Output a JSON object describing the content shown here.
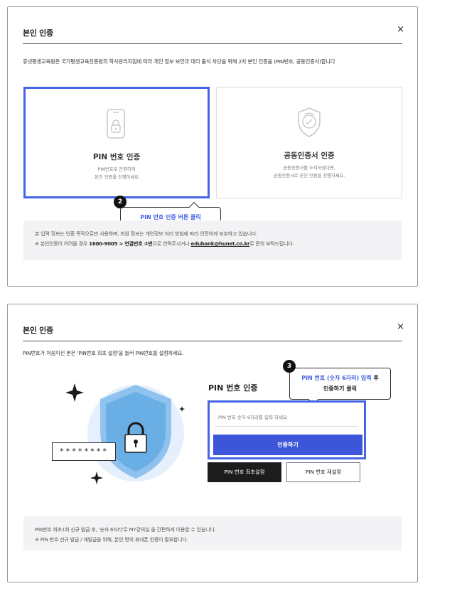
{
  "dialog1": {
    "title": "본인 인증",
    "close": "×",
    "description": "휴넷평생교육원은 국가평생교육진흥원의 학사관리지침에 따라 개인 정보 보안과 대리 출석 차단을 위해 2차 본인 인증을 (PIN번호, 공동인증서)합니다",
    "cards": [
      {
        "title": "PIN 번호 인증",
        "sub1": "PIN번호로 간편하게",
        "sub2": "본인 인증을 진행하세요",
        "icon": "phone-lock-icon",
        "selected": true
      },
      {
        "title": "공동인증서 인증",
        "sub1": "공동인증서를 소지하셨다면,",
        "sub2": "공동인증서로 본인 인증을 진행하세요.",
        "icon": "shield-certificate-icon",
        "selected": false
      }
    ],
    "step_badge": "2",
    "tooltip": "PIN 번호 인증 버튼 클릭",
    "note": {
      "line1": "본 입력 정보는 인증 목적으로만 사용하며, 회원 정보는 개인정보 처리 방침에 따라 안전하게 보호하고 있습니다.",
      "line2_prefix": "※ 본인인증이 어려울 경우 ",
      "line2_phone": "1600-9005 > 연결번호 ②번",
      "line2_mid": "으로 연락주시거나 ",
      "line2_email": "edubank@hunet.co.kr",
      "line2_suffix": "로 문의 부탁드립니다."
    }
  },
  "dialog2": {
    "title": "본인 인증",
    "close": "×",
    "description": "PIN번호가 처음이신 분은 'PIN번호 최초 설정'을 눌러 PIN번호를 설정하세요.",
    "illustration_text": "********",
    "pin_title": "PIN 번호 인증",
    "pin_placeholder": "PIN 번호 숫자 6자리를 입력 하세요",
    "submit_label": "인증하기",
    "first_setup_label": "PIN 번호 최초설정",
    "reset_label": "PIN 번호 재설정",
    "step_badge": "3",
    "tooltip_blue": "PIN 번호 (숫자 6자리) 입력",
    "tooltip_black": " 후",
    "tooltip_line2": "인증하기 클릭",
    "note": {
      "line1": "PIN번호 최초1회 신규 발급 후, '숫자 6자리'로 MY강의실 을 간편하게 이용할 수 있습니다.",
      "line2": "※ PIN 번호 신규 발급 / 재발급을 위해, 본인 명의 휴대폰 인증이 필요합니다."
    }
  },
  "colors": {
    "accent": "#4564e6",
    "button": "#3d55d8",
    "dark_button": "#1c1c1c",
    "note_bg": "#f3f3f5"
  }
}
